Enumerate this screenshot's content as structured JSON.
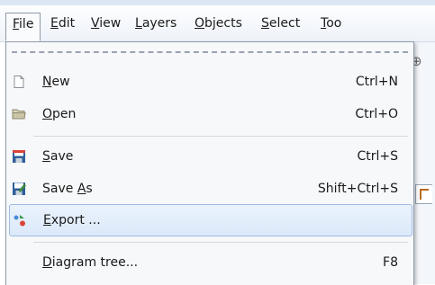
{
  "menubar": {
    "items": [
      {
        "pre": "",
        "key": "F",
        "post": "ile"
      },
      {
        "pre": "",
        "key": "E",
        "post": "dit"
      },
      {
        "pre": "",
        "key": "V",
        "post": "iew"
      },
      {
        "pre": "",
        "key": "L",
        "post": "ayers"
      },
      {
        "pre": "",
        "key": "O",
        "post": "bjects"
      },
      {
        "pre": "",
        "key": "S",
        "post": "elect"
      },
      {
        "pre": "",
        "key": "T",
        "post": "oo"
      }
    ]
  },
  "file_menu": {
    "items": [
      {
        "pre": "",
        "key": "N",
        "post": "ew",
        "shortcut": "Ctrl+N",
        "icon": "new-document-icon"
      },
      {
        "pre": "",
        "key": "O",
        "post": "pen",
        "shortcut": "Ctrl+O",
        "icon": "folder-icon"
      },
      {
        "pre": "",
        "key": "S",
        "post": "ave",
        "shortcut": "Ctrl+S",
        "icon": "save-icon"
      },
      {
        "pre": "Save ",
        "key": "A",
        "post": "s",
        "shortcut": "Shift+Ctrl+S",
        "icon": "save-as-icon"
      },
      {
        "pre": "",
        "key": "E",
        "post": "xport ...",
        "shortcut": "",
        "icon": "export-icon"
      },
      {
        "pre": "",
        "key": "D",
        "post": "iagram tree...",
        "shortcut": "F8",
        "icon": ""
      }
    ]
  }
}
